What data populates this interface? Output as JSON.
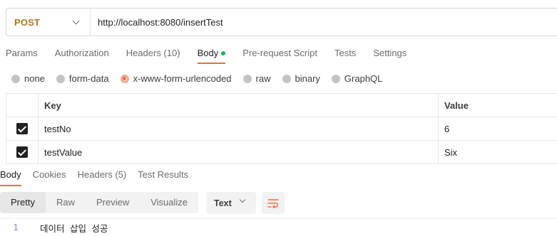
{
  "request": {
    "method": "POST",
    "url": "http://localhost:8080/insertTest"
  },
  "request_tabs": [
    {
      "label": "Params"
    },
    {
      "label": "Authorization"
    },
    {
      "label": "Headers (10)"
    },
    {
      "label": "Body"
    },
    {
      "label": "Pre-request Script"
    },
    {
      "label": "Tests"
    },
    {
      "label": "Settings"
    }
  ],
  "body_types": [
    {
      "label": "none"
    },
    {
      "label": "form-data"
    },
    {
      "label": "x-www-form-urlencoded"
    },
    {
      "label": "raw"
    },
    {
      "label": "binary"
    },
    {
      "label": "GraphQL"
    }
  ],
  "selected_body_type": "x-www-form-urlencoded",
  "params_table": {
    "headers": {
      "key": "Key",
      "value": "Value"
    },
    "rows": [
      {
        "checked": true,
        "key": "testNo",
        "value": "6"
      },
      {
        "checked": true,
        "key": "testValue",
        "value": "Six"
      }
    ]
  },
  "response_tabs": [
    {
      "label": "Body"
    },
    {
      "label": "Cookies"
    },
    {
      "label": "Headers (5)"
    },
    {
      "label": "Test Results"
    }
  ],
  "view_modes": [
    {
      "label": "Pretty"
    },
    {
      "label": "Raw"
    },
    {
      "label": "Preview"
    },
    {
      "label": "Visualize"
    }
  ],
  "format": "Text",
  "response_lines": [
    {
      "num": "1",
      "text": "데이터 삽입 성공"
    }
  ],
  "colors": {
    "accent": "#f26b3a",
    "method_post": "#b0771f",
    "status_dot": "#0cbb52"
  },
  "icons": [
    "chevron-down-icon",
    "wrap-lines-icon",
    "checkbox-checked-icon"
  ]
}
